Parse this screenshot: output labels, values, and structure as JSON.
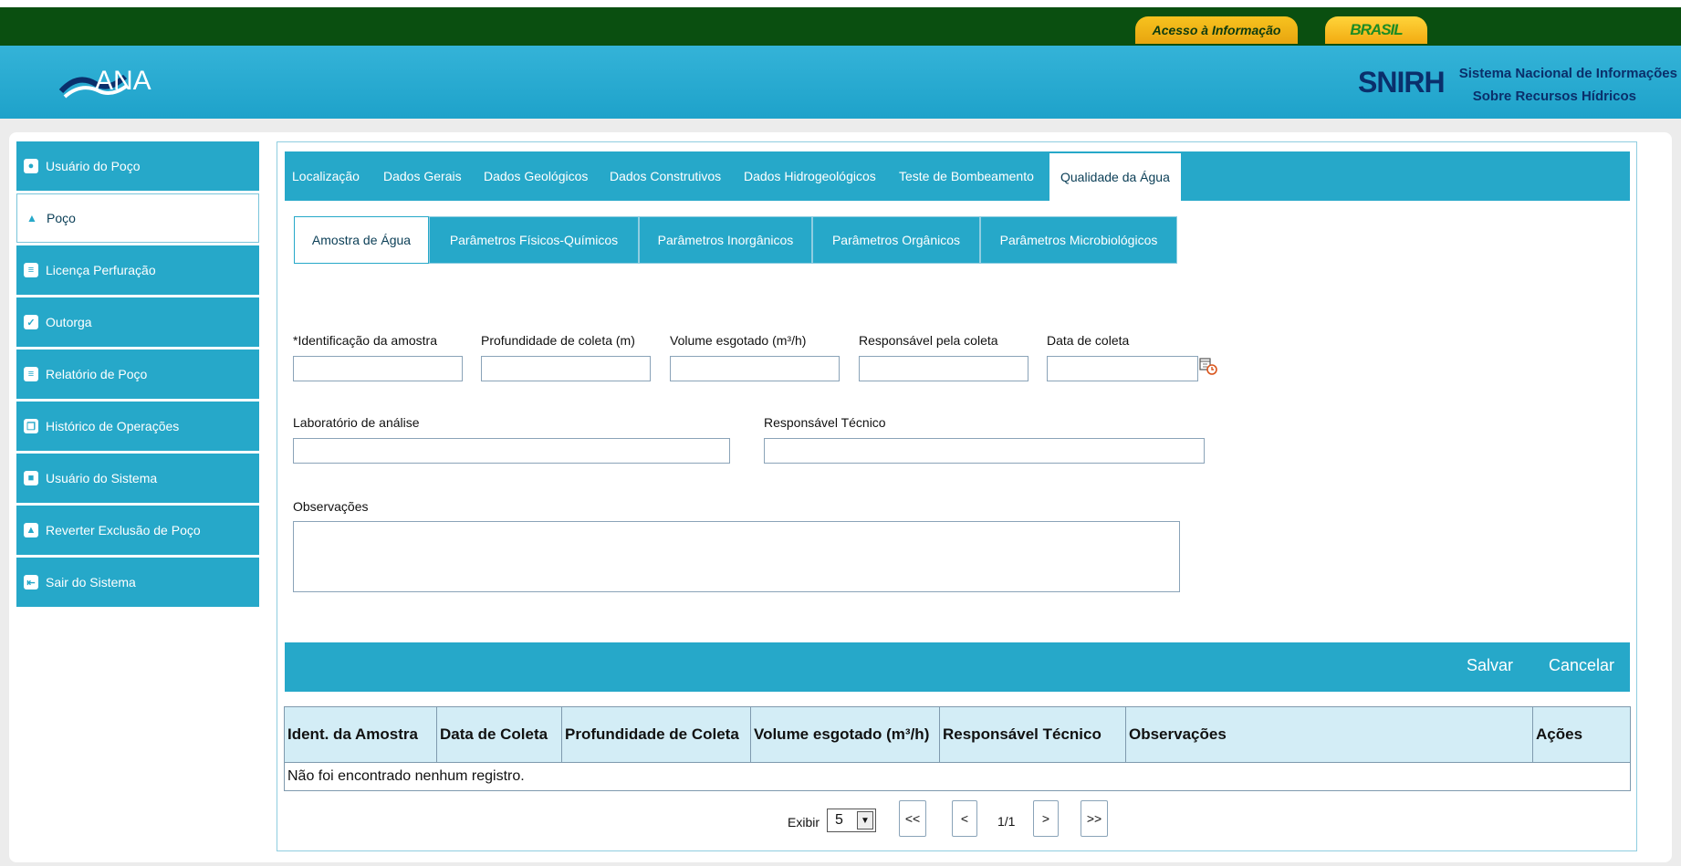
{
  "gov_bar": {
    "acesso_label": "Acesso à Informação",
    "brasil_label": "BRASIL"
  },
  "header": {
    "logo_text": "ANA",
    "snirh_logo": "SNIRH",
    "snirh_line1": "Sistema Nacional de Informações",
    "snirh_line2": "Sobre Recursos Hídricos"
  },
  "sidebar": {
    "items": [
      {
        "label": "Usuário do Poço",
        "icon": "user-icon"
      },
      {
        "label": "Poço",
        "icon": "drop-icon"
      },
      {
        "label": "Licença Perfuração",
        "icon": "document-icon"
      },
      {
        "label": "Outorga",
        "icon": "checklist-icon"
      },
      {
        "label": "Relatório de Poço",
        "icon": "report-icon"
      },
      {
        "label": "Histórico de Operações",
        "icon": "copy-icon"
      },
      {
        "label": "Usuário do Sistema",
        "icon": "monitor-icon"
      },
      {
        "label": "Reverter Exclusão de Poço",
        "icon": "drop-icon"
      },
      {
        "label": "Sair do Sistema",
        "icon": "exit-icon"
      }
    ],
    "active_index": 1
  },
  "tabs": [
    "Localização",
    "Dados Gerais",
    "Dados Geológicos",
    "Dados Construtivos",
    "Dados Hidrogeológicos",
    "Teste de Bombeamento",
    "Qualidade da Água"
  ],
  "active_tab": "Qualidade da Água",
  "subtabs": [
    "Amostra de Água",
    "Parâmetros Físicos-Químicos",
    "Parâmetros Inorgânicos",
    "Parâmetros Orgânicos",
    "Parâmetros Microbiológicos"
  ],
  "form": {
    "id_amostra_label": "*Identificação da amostra",
    "profundidade_label": "Profundidade de coleta (m)",
    "volume_label": "Volume esgotado (m³/h)",
    "responsavel_coleta_label": "Responsável pela coleta",
    "data_coleta_label": "Data de coleta",
    "laboratorio_label": "Laboratório de análise",
    "responsavel_tecnico_label": "Responsável Técnico",
    "observacoes_label": "Observações",
    "id_amostra_value": "",
    "profundidade_value": "",
    "volume_value": "",
    "responsavel_coleta_value": "",
    "data_coleta_value": "",
    "laboratorio_value": "",
    "responsavel_tecnico_value": "",
    "observacoes_value": ""
  },
  "actions": {
    "save_label": "Salvar",
    "cancel_label": "Cancelar"
  },
  "table": {
    "headers": [
      "Ident. da Amostra",
      "Data de Coleta",
      "Profundidade de Coleta",
      "Volume esgotado (m³/h)",
      "Responsável Técnico",
      "Observações",
      "Ações"
    ],
    "empty_message": "Não foi encontrado nenhum registro."
  },
  "pagination": {
    "show_label": "Exibir",
    "page_size": "5",
    "first_label": "<<",
    "prev_label": "<",
    "page_info": "1/1",
    "next_label": ">",
    "last_label": ">>"
  }
}
